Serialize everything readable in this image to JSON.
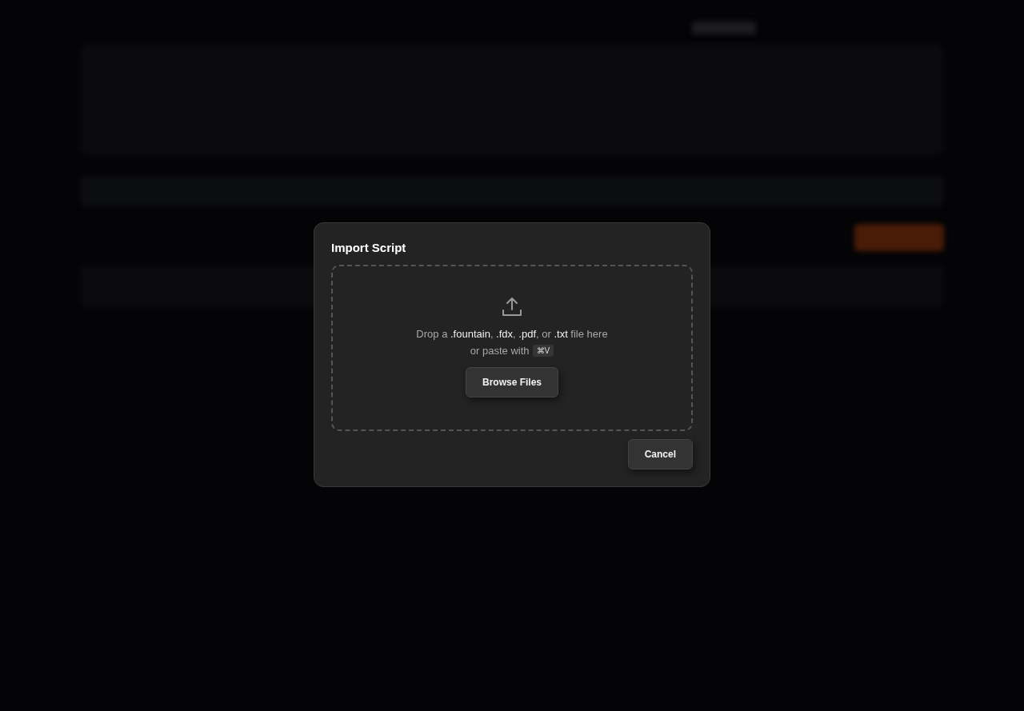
{
  "dialog": {
    "title": "Import Script",
    "dropzone": {
      "text": "Drop a **.fountain**, **.fdx**, **.pdf**, or **.txt** file here",
      "paste_text": "or paste with",
      "shortcut": "⌘V",
      "button": "Browse Files"
    },
    "buttons": [
      {
        "label": "Cancel"
      }
    ]
  }
}
